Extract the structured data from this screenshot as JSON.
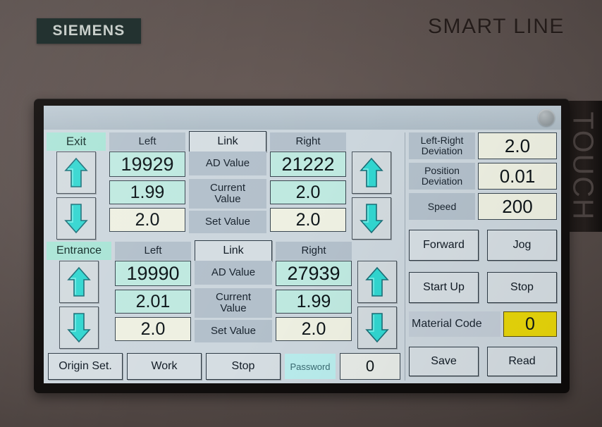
{
  "brand": {
    "logo_text": "SIEMENS",
    "product_line": "SMART LINE",
    "bezel_text": "TOUCH"
  },
  "titlebar": {
    "status_indicator": "status-led"
  },
  "sections": [
    {
      "name": "Exit",
      "tag": "Exit",
      "left_header": "Left",
      "link_button": "Link",
      "right_header": "Right",
      "rows": [
        {
          "label": "AD Value",
          "left": "19929",
          "right": "21222"
        },
        {
          "label": "Current Value",
          "left": "1.99",
          "right": "2.0"
        },
        {
          "label": "Set Value",
          "left": "2.0",
          "right": "2.0"
        }
      ]
    },
    {
      "name": "Entrance",
      "tag": "Entrance",
      "left_header": "Left",
      "link_button": "Link",
      "right_header": "Right",
      "rows": [
        {
          "label": "AD Value",
          "left": "19990",
          "right": "27939"
        },
        {
          "label": "Current Value",
          "left": "2.01",
          "right": "1.99"
        },
        {
          "label": "Set Value",
          "left": "2.0",
          "right": "2.0"
        }
      ]
    }
  ],
  "right_panel": {
    "readouts": [
      {
        "label": "Left-Right Deviation",
        "value": "2.0"
      },
      {
        "label": "Position Deviation",
        "value": "0.01"
      },
      {
        "label": "Speed",
        "value": "200"
      }
    ],
    "buttons": {
      "forward": "Forward",
      "jog": "Jog",
      "start_up": "Start Up",
      "stop": "Stop"
    },
    "material_code": {
      "label": "Material Code",
      "value": "0"
    },
    "save": "Save",
    "read": "Read"
  },
  "toolbar": {
    "origin_set": "Origin Set.",
    "work": "Work",
    "stop": "Stop",
    "password_label": "Password",
    "password_value": "0"
  },
  "colors": {
    "screen_bg": "#ccd6dd",
    "label_bg": "#b3c0cb",
    "field_cyan": "#bfe9e0",
    "field_ivory": "#eef0e2",
    "field_yellow": "#e8d60a",
    "tag_mint": "#a9e4d6",
    "arrow_fill": "#31d6d0",
    "bezel": "#151211",
    "siemens_plate": "#233230"
  }
}
